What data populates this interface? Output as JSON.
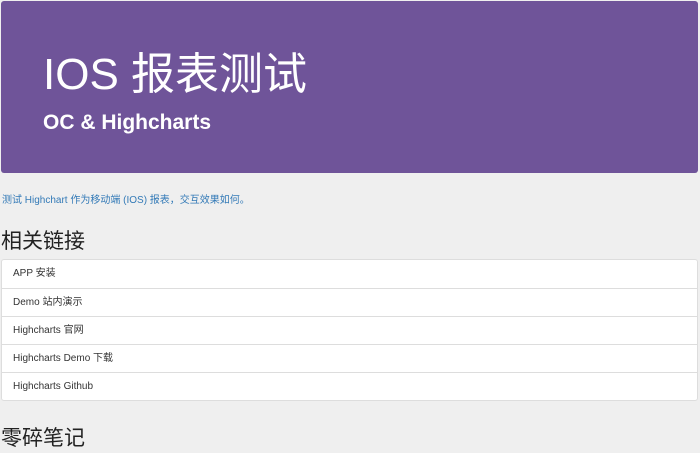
{
  "hero": {
    "title": "IOS 报表测试",
    "subtitle": "OC & Highcharts"
  },
  "intro": {
    "text": "测试 Highchart 作为移动端 (IOS) 报表，交互效果如何。"
  },
  "links_section": {
    "title": "相关链接",
    "items": [
      {
        "label": "APP 安装"
      },
      {
        "label": "Demo 站内演示"
      },
      {
        "label": "Highcharts 官网"
      },
      {
        "label": "Highcharts Demo 下载"
      },
      {
        "label": "Highcharts Github"
      }
    ]
  },
  "notes_section": {
    "title": "零碎笔记"
  },
  "colors": {
    "hero_background": "#6f5499",
    "link_text": "#337ab7",
    "page_background": "#efefef"
  }
}
